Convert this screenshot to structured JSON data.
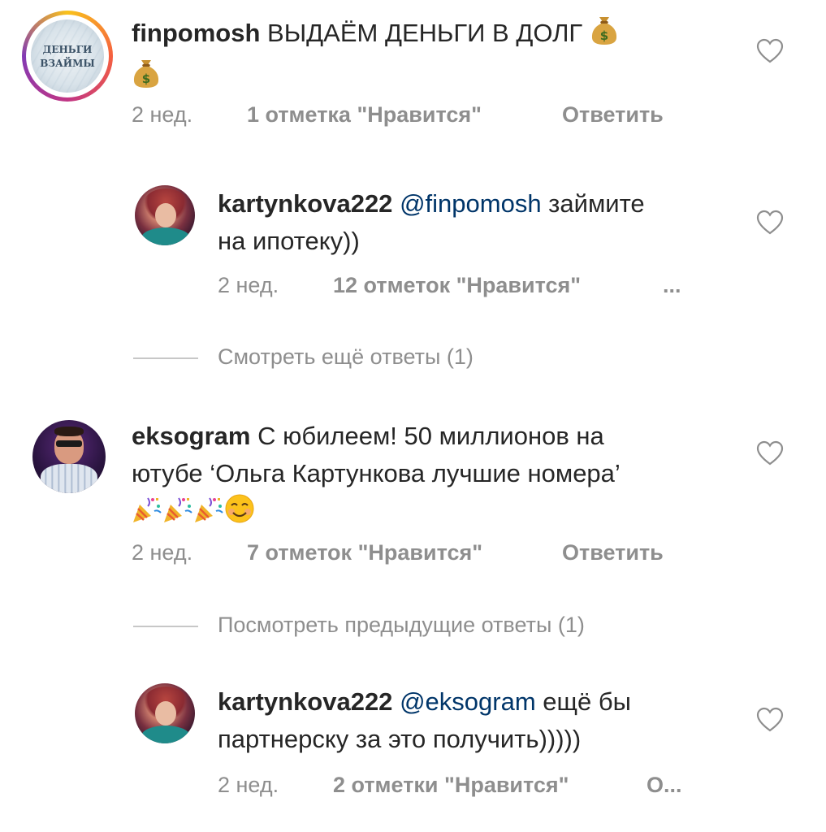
{
  "comments": [
    {
      "username": "finpomosh",
      "mention": "",
      "text": " ВЫДАЁМ ДЕНЬГИ В ДОЛГ ",
      "avatar_text_line1": "ДЕНЬГИ",
      "avatar_text_line2": "ВЗАЙМЫ",
      "time": "2 нед.",
      "likes": "1 отметка \"Нравится\"",
      "reply": "Ответить",
      "emoji": [
        "money-bag",
        "money-bag"
      ]
    },
    {
      "username": "kartynkova222",
      "mention": "@finpomosh",
      "text_line1": " займите",
      "text_line2": "на ипотеку))",
      "time": "2 нед.",
      "likes": "12 отметок \"Нравится\"",
      "reply": "..."
    },
    {
      "username": "eksogram",
      "mention": "",
      "text_line1": " С юбилеем! 50 миллионов на",
      "text_line2": "ютубе ‘Ольга Картункова лучшие номера’",
      "time": "2 нед.",
      "likes": "7 отметок \"Нравится\"",
      "reply": "Ответить",
      "emoji": [
        "party-popper",
        "party-popper",
        "party-popper",
        "smiling-face"
      ]
    },
    {
      "username": "kartynkova222",
      "mention": "@eksogram",
      "text_line1": " ещё бы",
      "text_line2": "партнерску за это получить)))))",
      "time": "2 нед.",
      "likes": "2 отметки \"Нравится\"",
      "reply": "О..."
    }
  ],
  "threads": {
    "more_replies_1": "Смотреть ещё ответы (1)",
    "previous_replies_2": "Посмотреть предыдущие ответы (1)"
  },
  "colors": {
    "text": "#262626",
    "meta": "#8e8e8e",
    "mention": "#003569",
    "ring_start": "#f9c21b",
    "ring_end": "#c13584"
  }
}
